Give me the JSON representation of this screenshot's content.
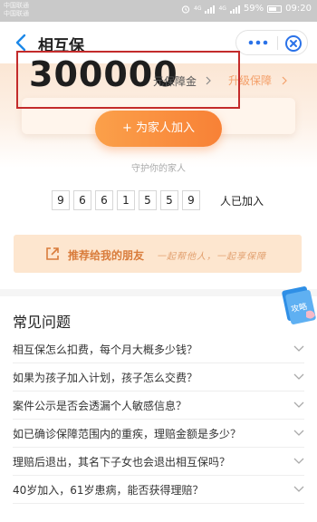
{
  "status_bar": {
    "carrier1": "中国联通",
    "carrier2": "中国联通",
    "network1": "4G",
    "network2": "4G",
    "battery": "59%",
    "time": "09:20"
  },
  "nav": {
    "title": "相互保"
  },
  "protection": {
    "amount": "300000",
    "amount_label": "元保障金",
    "upgrade_label": "升级保障"
  },
  "join_button": "+ 为家人加入",
  "guard_text": "守护你的家人",
  "member_count": {
    "digits": [
      "9",
      "6",
      "6",
      "1",
      "5",
      "5",
      "9"
    ],
    "suffix": "人已加入"
  },
  "recommend": {
    "label": "推荐给我的朋友",
    "slogan": "一起帮他人，一起享保障"
  },
  "faq": {
    "title": "常见问题",
    "items": [
      "相互保怎么扣费，每个月大概多少钱？",
      "如果为孩子加入计划，孩子怎么交费？",
      "案件公示是否会透漏个人敏感信息？",
      "如已确诊保障范围内的重疾，理赔金额是多少？",
      "理赔后退出，其名下子女也会退出相互保吗？",
      "40岁加入，61岁患病，能否获得理赔？"
    ]
  },
  "guide_badge": "攻略",
  "colors": {
    "accent_orange": "#f88136",
    "upgrade_orange": "#f4a06a",
    "highlight_red": "#c32b2b",
    "recommend_bg": "#fde6cf",
    "close_blue": "#2a72e8"
  }
}
